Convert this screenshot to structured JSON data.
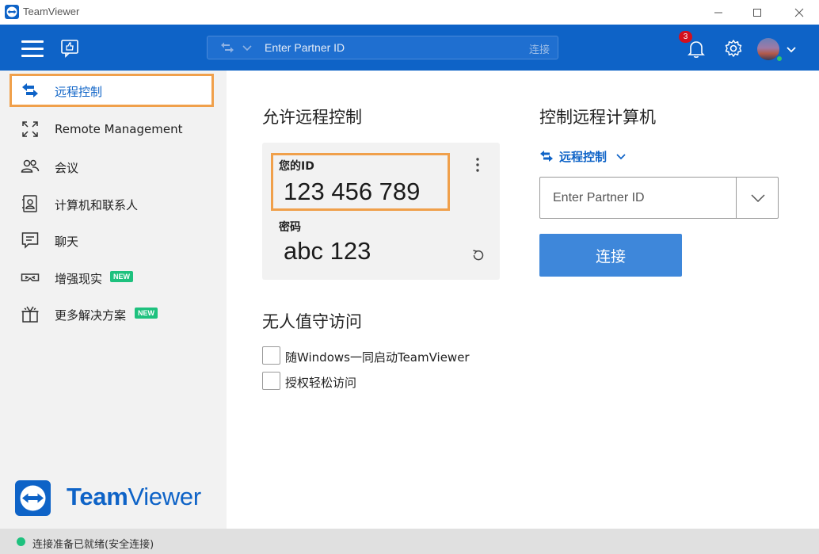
{
  "window": {
    "title": "TeamViewer"
  },
  "header": {
    "search_placeholder": "Enter Partner ID",
    "search_connect": "连接",
    "notification_count": "3"
  },
  "sidebar": {
    "items": [
      {
        "label": "远程控制",
        "icon": "arrows-exchange-icon",
        "active": true
      },
      {
        "label": "Remote Management",
        "icon": "expand-arrows-icon"
      },
      {
        "label": "会议",
        "icon": "people-icon"
      },
      {
        "label": "计算机和联系人",
        "icon": "contact-card-icon"
      },
      {
        "label": "聊天",
        "icon": "chat-icon"
      },
      {
        "label": "增强现实",
        "icon": "ar-glasses-icon",
        "badge": "NEW"
      },
      {
        "label": "更多解决方案",
        "icon": "gift-icon",
        "badge": "NEW"
      }
    ],
    "brand_bold": "Team",
    "brand_regular": "Viewer"
  },
  "allow": {
    "title": "允许远程控制",
    "id_label": "您的ID",
    "id_value": "123 456 789",
    "password_label": "密码",
    "password_value": "abc 123"
  },
  "unattended": {
    "title": "无人值守访问",
    "options": [
      {
        "label": "随Windows一同启动TeamViewer",
        "checked": false
      },
      {
        "label": "授权轻松访问",
        "checked": false
      }
    ]
  },
  "control": {
    "title": "控制远程计算机",
    "mode_label": "远程控制",
    "partner_placeholder": "Enter Partner ID",
    "connect_label": "连接"
  },
  "status": {
    "text": "连接准备已就绪(安全连接)",
    "color": "#1ec17e"
  },
  "colors": {
    "brand": "#0e63c7",
    "highlight": "#f0a04b",
    "button": "#3e87da"
  }
}
